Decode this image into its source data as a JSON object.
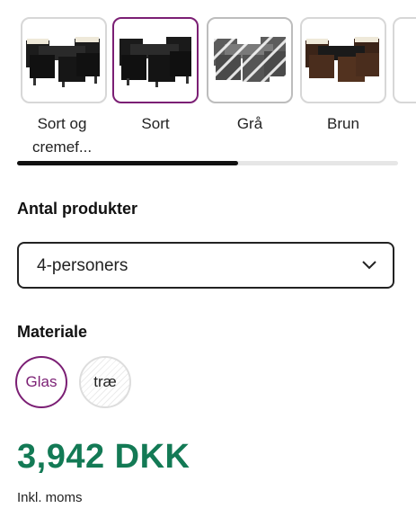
{
  "variants": [
    {
      "label": "Sort og cremef...",
      "state": "default",
      "image": "furniture-black-cream"
    },
    {
      "label": "Sort",
      "state": "selected",
      "image": "furniture-black"
    },
    {
      "label": "Grå",
      "state": "unavailable",
      "image": "furniture-grey"
    },
    {
      "label": "Brun",
      "state": "default",
      "image": "furniture-brown"
    }
  ],
  "variant_scroll_progress": 0.58,
  "quantity": {
    "title": "Antal produkter",
    "selected": "4-personers"
  },
  "material": {
    "title": "Materiale",
    "options": [
      {
        "label": "Glas",
        "state": "selected"
      },
      {
        "label": "træ",
        "state": "default"
      }
    ]
  },
  "price": {
    "amount": "3,942 DKK",
    "note": "Inkl. moms"
  },
  "colors": {
    "accent": "#7b1f74",
    "price": "#137a55"
  }
}
